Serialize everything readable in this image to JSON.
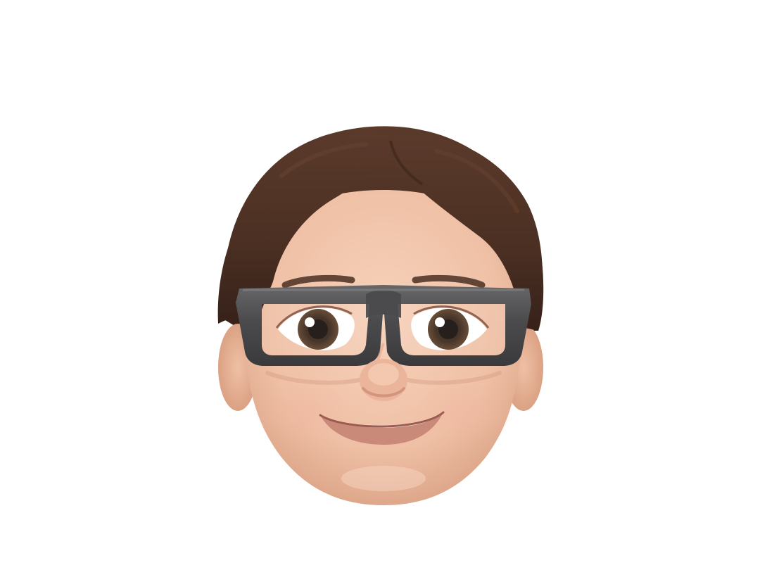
{
  "image": {
    "subject": "memoji-avatar",
    "background_color": "#ffffff",
    "colors": {
      "hair": "#4a2f22",
      "hair_highlight": "#6b4633",
      "skin": "#f2c4a8",
      "skin_shadow": "#d99f80",
      "glasses_frame": "#4b4b4d",
      "iris": "#5a3f2a",
      "pupil": "#1a120d",
      "sclera": "#ffffff",
      "mouth": "#c98a7a",
      "teeth": "#ffffff"
    },
    "icons": {
      "avatar": "memoji-face-icon",
      "glasses": "glasses-icon"
    }
  }
}
